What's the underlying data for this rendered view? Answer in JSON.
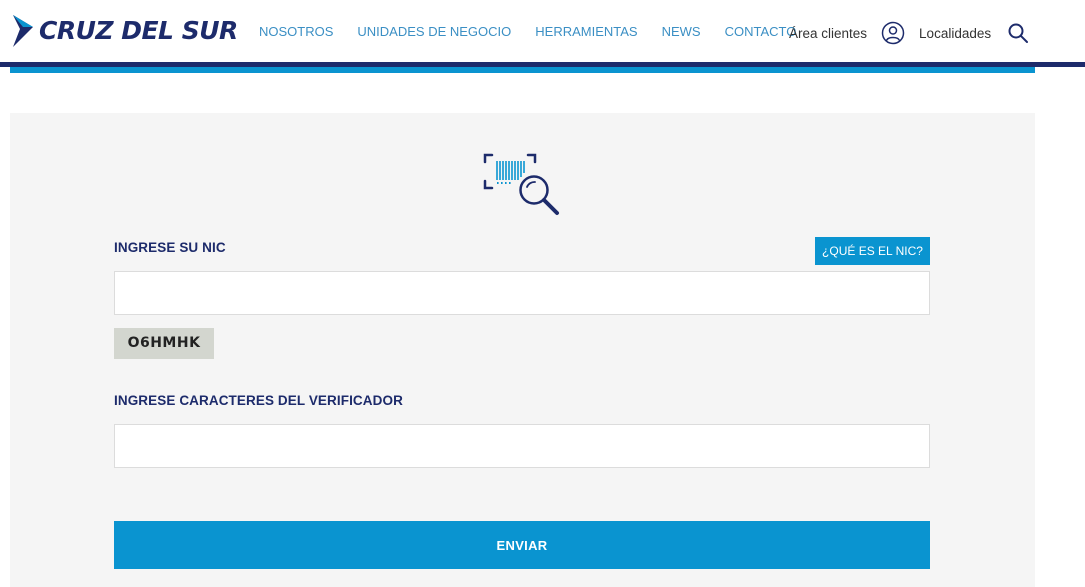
{
  "header": {
    "logo_text": "CRUZ DEL SUR",
    "nav": [
      "NOSOTROS",
      "UNIDADES DE NEGOCIO",
      "HERRAMIENTAS",
      "NEWS",
      "CONTACTO"
    ],
    "client_area": "Área clientes",
    "locations": "Localidades"
  },
  "form": {
    "nic_label": "INGRESE SU NIC",
    "nic_help": "¿QUÉ ES EL NIC?",
    "nic_value": "",
    "captcha_code": "O6HMHK",
    "verifier_label": "INGRESE CARACTERES DEL VERIFICADOR",
    "verifier_value": "",
    "submit_label": "ENVIAR"
  },
  "colors": {
    "brand_navy": "#1d2b6b",
    "brand_blue": "#0a94d0",
    "panel_bg": "#f5f5f5"
  },
  "icons": {
    "logo": "arrow-logo-icon",
    "user": "user-circle-icon",
    "search": "search-icon",
    "form": "barcode-search-icon"
  }
}
